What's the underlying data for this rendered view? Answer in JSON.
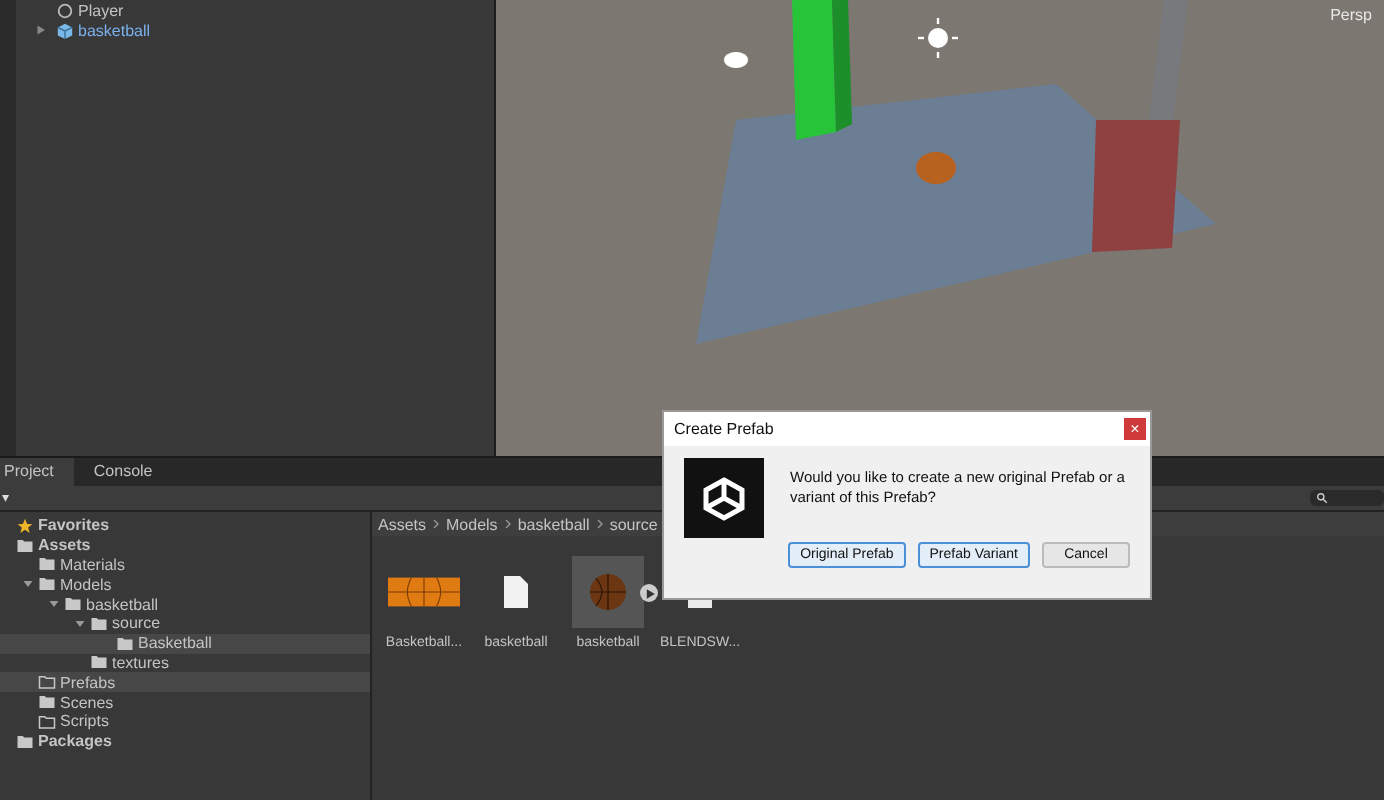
{
  "hierarchy": {
    "items": [
      {
        "label": "Player",
        "kind": "object",
        "expandable": false
      },
      {
        "label": "basketball",
        "kind": "prefab",
        "expandable": true
      }
    ]
  },
  "scene": {
    "view_label": "Persp"
  },
  "tabs": [
    {
      "label": "Project",
      "selected": true
    },
    {
      "label": "Console",
      "selected": false
    }
  ],
  "toolbar": {
    "add_caret": "▾"
  },
  "tree": [
    {
      "label": "Favorites",
      "kind": "favorites",
      "selected": false
    },
    {
      "label": "Assets",
      "kind": "root",
      "selected": false,
      "children": [
        {
          "label": "Materials",
          "kind": "folder",
          "selected": false
        },
        {
          "label": "Models",
          "kind": "folder",
          "selected": false,
          "children": [
            {
              "label": "basketball",
              "kind": "folder",
              "selected": false,
              "children": [
                {
                  "label": "source",
                  "kind": "folder",
                  "selected": false,
                  "children": [
                    {
                      "label": "Basketball",
                      "kind": "folder",
                      "selected": true
                    }
                  ]
                },
                {
                  "label": "textures",
                  "kind": "folder",
                  "selected": false
                }
              ]
            }
          ]
        },
        {
          "label": "Prefabs",
          "kind": "empty_folder",
          "selected": true
        },
        {
          "label": "Scenes",
          "kind": "folder",
          "selected": false
        },
        {
          "label": "Scripts",
          "kind": "empty_folder",
          "selected": false
        }
      ]
    },
    {
      "label": "Packages",
      "kind": "root",
      "selected": false
    }
  ],
  "breadcrumb": [
    "Assets",
    "Models",
    "basketball",
    "source"
  ],
  "assets": [
    {
      "label": "Basketball...",
      "kind": "texture",
      "selected": false
    },
    {
      "label": "basketball",
      "kind": "file",
      "selected": false
    },
    {
      "label": "basketball",
      "kind": "model",
      "selected": true
    },
    {
      "label": "BLENDSW...",
      "kind": "blend",
      "selected": false
    }
  ],
  "dialog": {
    "title": "Create Prefab",
    "close": "×",
    "message": "Would you like to create a new original Prefab or a variant of this Prefab?",
    "buttons": [
      {
        "label": "Original Prefab",
        "highlighted": true
      },
      {
        "label": "Prefab Variant",
        "highlighted": true
      },
      {
        "label": "Cancel",
        "highlighted": false
      }
    ]
  }
}
